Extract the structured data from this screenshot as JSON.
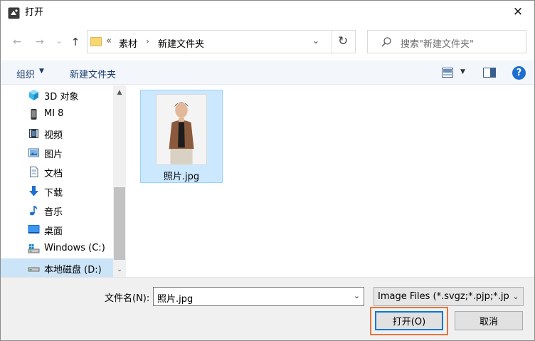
{
  "window": {
    "title": "打开",
    "close_symbol": "✕"
  },
  "nav_buttons": {
    "back": "←",
    "forward": "→",
    "recent": "⌄",
    "up": "↑"
  },
  "address": {
    "chevrons": "«",
    "segments": [
      "素材",
      "新建文件夹"
    ],
    "separator": "›",
    "dropdown": "⌄",
    "refresh": "↻"
  },
  "search": {
    "placeholder": "搜索\"新建文件夹\""
  },
  "toolbar": {
    "organize_label": "组织",
    "dropdown_symbol": "▼",
    "new_folder_label": "新建文件夹",
    "help_symbol": "?"
  },
  "sidebar": {
    "items": [
      {
        "label": "3D 对象",
        "icon": "3d-objects-icon"
      },
      {
        "label": "MI 8",
        "icon": "phone-icon"
      },
      {
        "label": "视频",
        "icon": "video-icon"
      },
      {
        "label": "图片",
        "icon": "pictures-icon"
      },
      {
        "label": "文档",
        "icon": "documents-icon"
      },
      {
        "label": "下载",
        "icon": "download-icon"
      },
      {
        "label": "音乐",
        "icon": "music-icon"
      },
      {
        "label": "桌面",
        "icon": "desktop-icon"
      },
      {
        "label": "Windows (C:)",
        "icon": "drive-windows-icon"
      },
      {
        "label": "本地磁盘 (D:)",
        "icon": "drive-icon",
        "selected": true
      }
    ],
    "scroll_up": "▲",
    "scroll_down": "⌄"
  },
  "files": [
    {
      "name": "照片.jpg",
      "selected": true
    }
  ],
  "footer": {
    "filename_label": "文件名(N):",
    "filename_value": "照片.jpg",
    "filename_dropdown": "⌄",
    "filter_value": "Image Files (*.svgz;*.pjp;*.jpeg",
    "filter_dropdown": "⌄",
    "open_label": "打开(O)",
    "cancel_label": "取消"
  },
  "colors": {
    "selection_bg": "#cce8ff",
    "nav_selected_bg": "#cce4f7",
    "highlight_border": "#e7743a",
    "accent": "#0078d7"
  }
}
